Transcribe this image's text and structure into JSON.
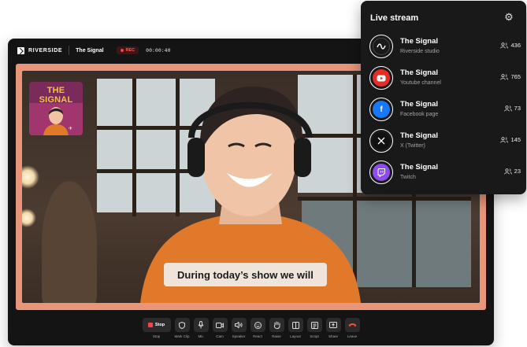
{
  "app": {
    "brand": "RIVERSIDE",
    "show_title": "The Signal",
    "rec_label": "REC",
    "timer": "00:00:40"
  },
  "stage": {
    "caption": "During today’s show we will",
    "thumbnail_title": "THE SIGNAL"
  },
  "toolbar": {
    "items": [
      {
        "label": "Stop",
        "icon": "stop-icon",
        "button_text": "Stop"
      },
      {
        "label": "Mark Clip",
        "icon": "shield-icon"
      },
      {
        "label": "Mic",
        "icon": "mic-icon"
      },
      {
        "label": "Cam",
        "icon": "camera-icon"
      },
      {
        "label": "Speaker",
        "icon": "speaker-icon"
      },
      {
        "label": "React",
        "icon": "emoji-icon"
      },
      {
        "label": "Raise",
        "icon": "hand-icon"
      },
      {
        "label": "Layout",
        "icon": "layout-icon"
      },
      {
        "label": "Script",
        "icon": "script-icon"
      },
      {
        "label": "Share",
        "icon": "share-icon"
      },
      {
        "label": "Leave",
        "icon": "phone-hangup-icon"
      }
    ]
  },
  "live_stream": {
    "title": "Live stream",
    "settings_icon": "gear-icon",
    "destinations": [
      {
        "name": "The Signal",
        "platform": "Riverside studio",
        "viewers": "436",
        "icon": "riverside-icon",
        "color": "#1a1a1a"
      },
      {
        "name": "The Signal",
        "platform": "Youtube channel",
        "viewers": "765",
        "icon": "youtube-icon",
        "color": "#e52d27"
      },
      {
        "name": "The Signal",
        "platform": "Facebook page",
        "viewers": "73",
        "icon": "facebook-icon",
        "color": "#1877f2"
      },
      {
        "name": "The Signal",
        "platform": "X (Twitter)",
        "viewers": "145",
        "icon": "x-icon",
        "color": "#111111"
      },
      {
        "name": "The Signal",
        "platform": "Twitch",
        "viewers": "23",
        "icon": "twitch-icon",
        "color": "#8f4bf0"
      }
    ]
  },
  "colors": {
    "stage_frame": "#e8957a",
    "rec": "#ff4040",
    "shirt": "#e0792a"
  }
}
